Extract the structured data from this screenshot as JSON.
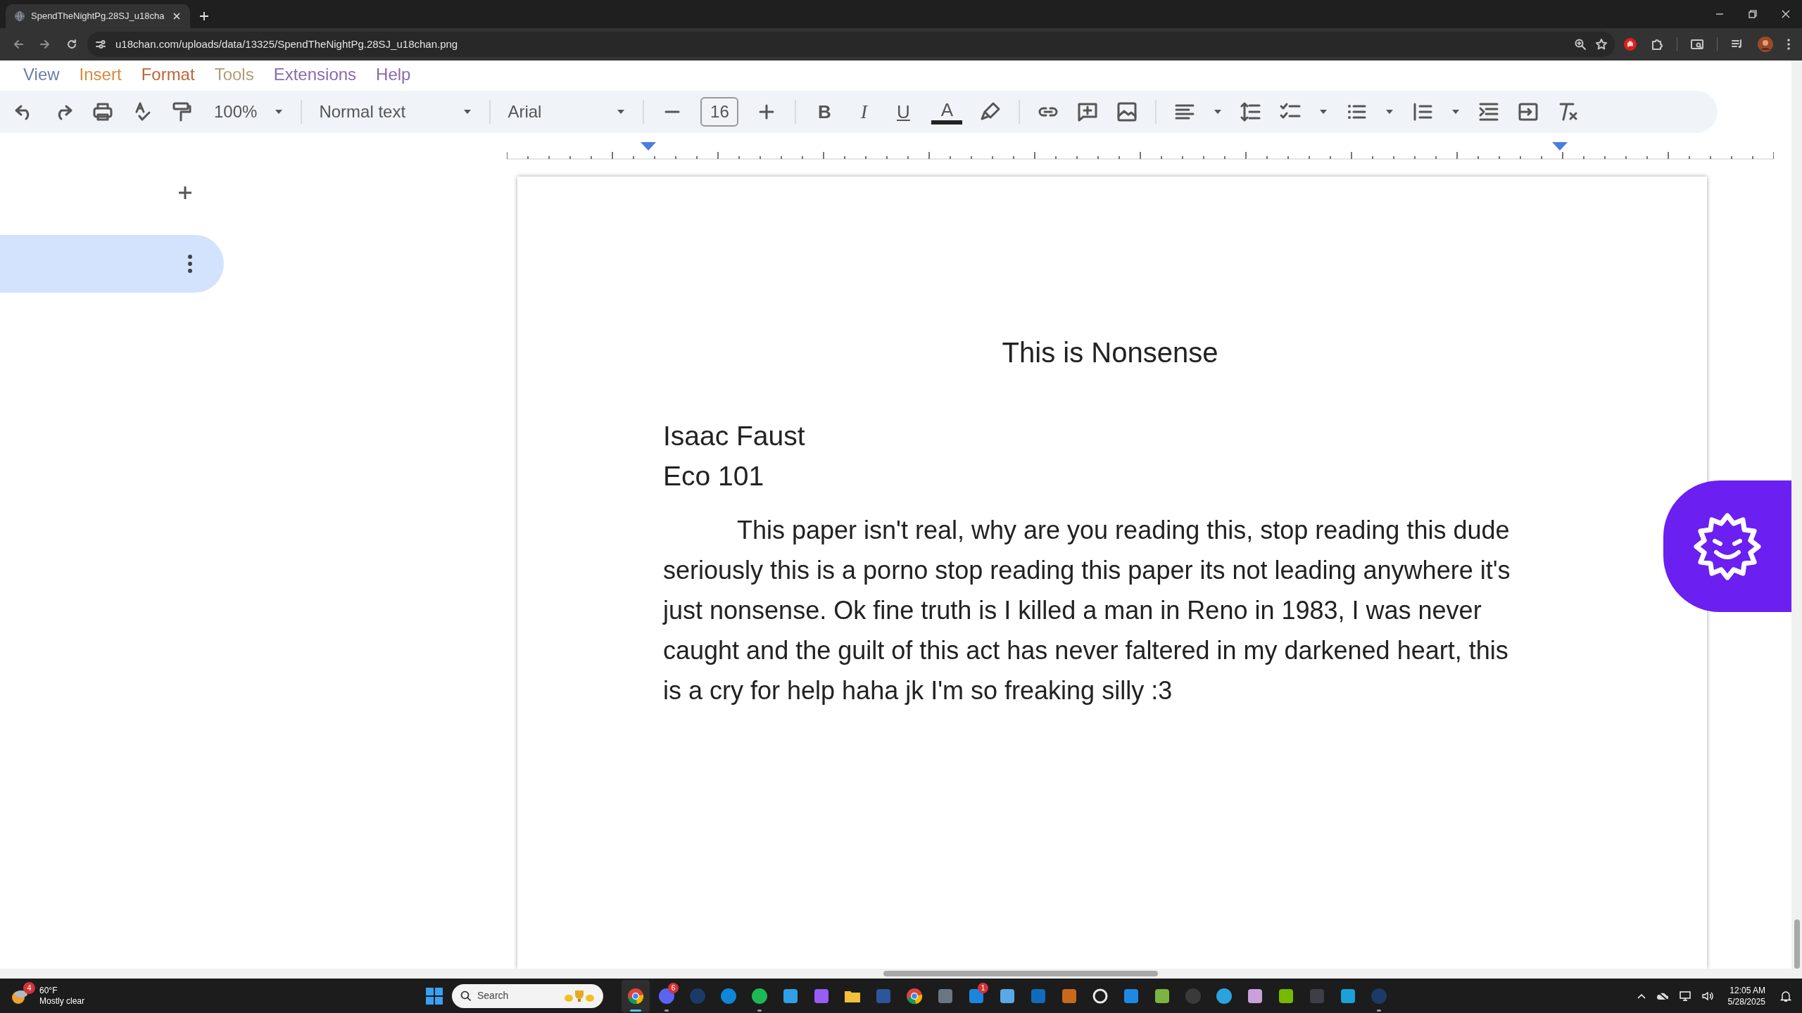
{
  "browser": {
    "tabs": [
      {
        "title": "SpendTheNightPg.28SJ_u18cha",
        "selected": true
      }
    ],
    "url": "u18chan.com/uploads/data/13325/SpendTheNightPg.28SJ_u18chan.png"
  },
  "image": {
    "menu": [
      "View",
      "Insert",
      "Format",
      "Tools",
      "Extensions",
      "Help"
    ],
    "toolbar": {
      "zoom": "100%",
      "style": "Normal text",
      "font": "Arial",
      "font_size": "16",
      "bold": "B",
      "italic": "I",
      "underline": "U",
      "text_color": "A"
    },
    "document": {
      "title": "This is Nonsense",
      "author": "Isaac Faust",
      "course": "Eco 101",
      "body": "This paper isn't real, why are you reading this, stop reading this dude seriously this is a porno stop reading this paper its not leading anywhere it's just nonsense. Ok fine truth is I killed a man in Reno in 1983, I was never caught and the guilt of this act has never faltered in my darkened heart, this is a cry for help haha jk I'm so freaking silly :3"
    }
  },
  "taskbar": {
    "weather": {
      "badge": "4",
      "temperature": "60°F",
      "condition": "Mostly clear"
    },
    "search": {
      "placeholder": "Search"
    },
    "apps": [
      {
        "running": true,
        "focused": true
      },
      {
        "running": true,
        "focused": false,
        "badge": "6"
      },
      {
        "running": false,
        "focused": false
      },
      {
        "running": false,
        "focused": false
      },
      {
        "running": true,
        "focused": false
      },
      {
        "running": false,
        "focused": false
      },
      {
        "running": false,
        "focused": false
      },
      {
        "running": false,
        "focused": false
      },
      {
        "running": false,
        "focused": false
      },
      {
        "running": false,
        "focused": false
      },
      {
        "running": false,
        "focused": false
      },
      {
        "running": false,
        "focused": false,
        "badge": "1"
      },
      {
        "running": false,
        "focused": false
      },
      {
        "running": false,
        "focused": false
      },
      {
        "running": false,
        "focused": false
      },
      {
        "running": false,
        "focused": false
      },
      {
        "running": false,
        "focused": false
      },
      {
        "running": false,
        "focused": false
      },
      {
        "running": false,
        "focused": false
      },
      {
        "running": false,
        "focused": false
      },
      {
        "running": false,
        "focused": false
      },
      {
        "running": false,
        "focused": false
      },
      {
        "running": false,
        "focused": false
      },
      {
        "running": false,
        "focused": false
      },
      {
        "running": true,
        "focused": false
      }
    ],
    "clock": {
      "time": "12:05 AM",
      "date": "5/28/2025"
    }
  }
}
